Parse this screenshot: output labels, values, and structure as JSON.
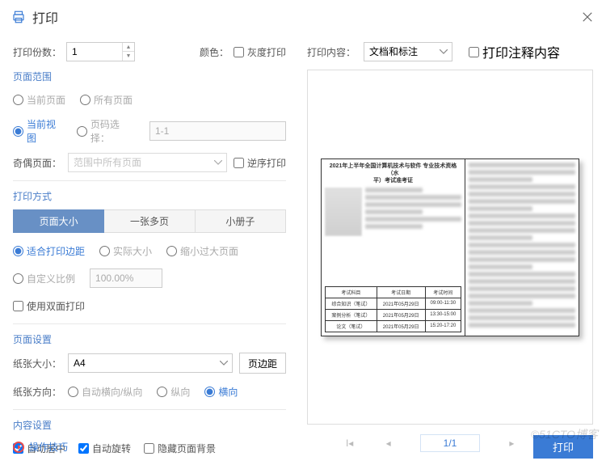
{
  "header": {
    "title": "打印"
  },
  "left": {
    "copies": {
      "label": "打印份数：",
      "value": "1"
    },
    "color": {
      "label": "颜色：",
      "grayscale_label": "灰度打印"
    },
    "range": {
      "title": "页面范围",
      "current_page": "当前页面",
      "all_pages": "所有页面",
      "current_view": "当前视图",
      "page_select": "页码选择：",
      "page_value": "1-1",
      "odd_even_label": "奇偶页面：",
      "odd_even_value": "范围中所有页面",
      "reverse": "逆序打印"
    },
    "mode": {
      "title": "打印方式",
      "tab1": "页面大小",
      "tab2": "一张多页",
      "tab3": "小册子",
      "fit_margins": "适合打印边距",
      "actual_size": "实际大小",
      "shrink_large": "缩小过大页面",
      "custom_scale": "自定义比例",
      "scale_value": "100.00%",
      "duplex": "使用双面打印"
    },
    "page_setup": {
      "title": "页面设置",
      "paper_size_label": "纸张大小：",
      "paper_size_value": "A4",
      "margins_btn": "页边距",
      "direction_label": "纸张方向：",
      "auto": "自动横向/纵向",
      "portrait": "纵向",
      "landscape": "横向"
    },
    "content": {
      "title": "内容设置",
      "auto_center": "自动居中",
      "auto_rotate": "自动旋转",
      "hide_bg": "隐藏页面背景"
    }
  },
  "right": {
    "print_content_label": "打印内容：",
    "print_content_value": "文档和标注",
    "print_annot": "打印注释内容",
    "doc_title_line1": "2021年上半年全国计算机技术与软件 专业技术资格（水",
    "doc_title_line2": "平）考试准考证",
    "table": {
      "h1": "考试科目",
      "h2": "考试日期",
      "h3": "考试时间",
      "r1c1": "综合知识（笔试）",
      "r1c2": "2021年05月29日",
      "r1c3": "09:00-11:30",
      "r2c1": "案例分析（笔试）",
      "r2c2": "2021年05月29日",
      "r2c3": "13:30-15:00",
      "r3c1": "论文（笔试）",
      "r3c2": "2021年05月29日",
      "r3c3": "15:20-17:20"
    },
    "page": "1/1"
  },
  "footer": {
    "tips": "操作技巧",
    "print_btn": "打印",
    "watermark": "©51CTO博客"
  }
}
